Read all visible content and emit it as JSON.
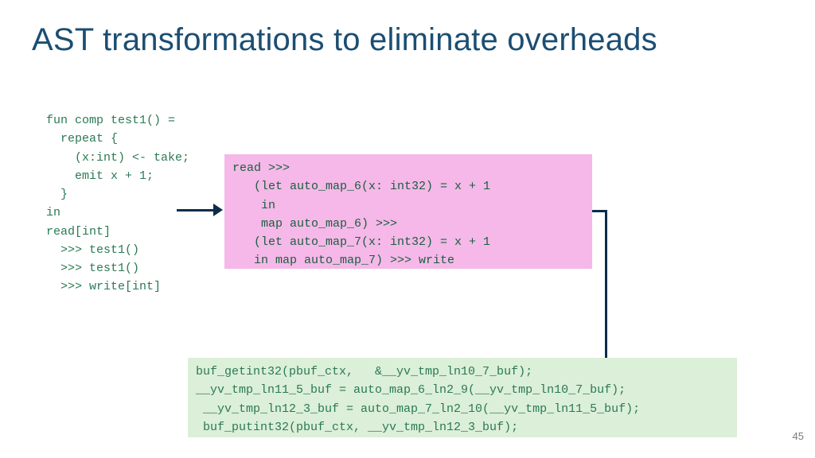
{
  "title": "AST transformations to eliminate overheads",
  "page_number": "45",
  "code_left": "fun comp test1() =\n  repeat {\n    (x:int) <- take;\n    emit x + 1;\n  }\nin\nread[int]\n  >>> test1()\n  >>> test1()\n  >>> write[int]",
  "code_pink": "read >>>\n   (let auto_map_6(x: int32) = x + 1\n    in\n    map auto_map_6) >>>\n   (let auto_map_7(x: int32) = x + 1\n   in map auto_map_7) >>> write",
  "code_green": "buf_getint32(pbuf_ctx,   &__yv_tmp_ln10_7_buf);\n__yv_tmp_ln11_5_buf = auto_map_6_ln2_9(__yv_tmp_ln10_7_buf);\n __yv_tmp_ln12_3_buf = auto_map_7_ln2_10(__yv_tmp_ln11_5_buf);\n buf_putint32(pbuf_ctx, __yv_tmp_ln12_3_buf);"
}
